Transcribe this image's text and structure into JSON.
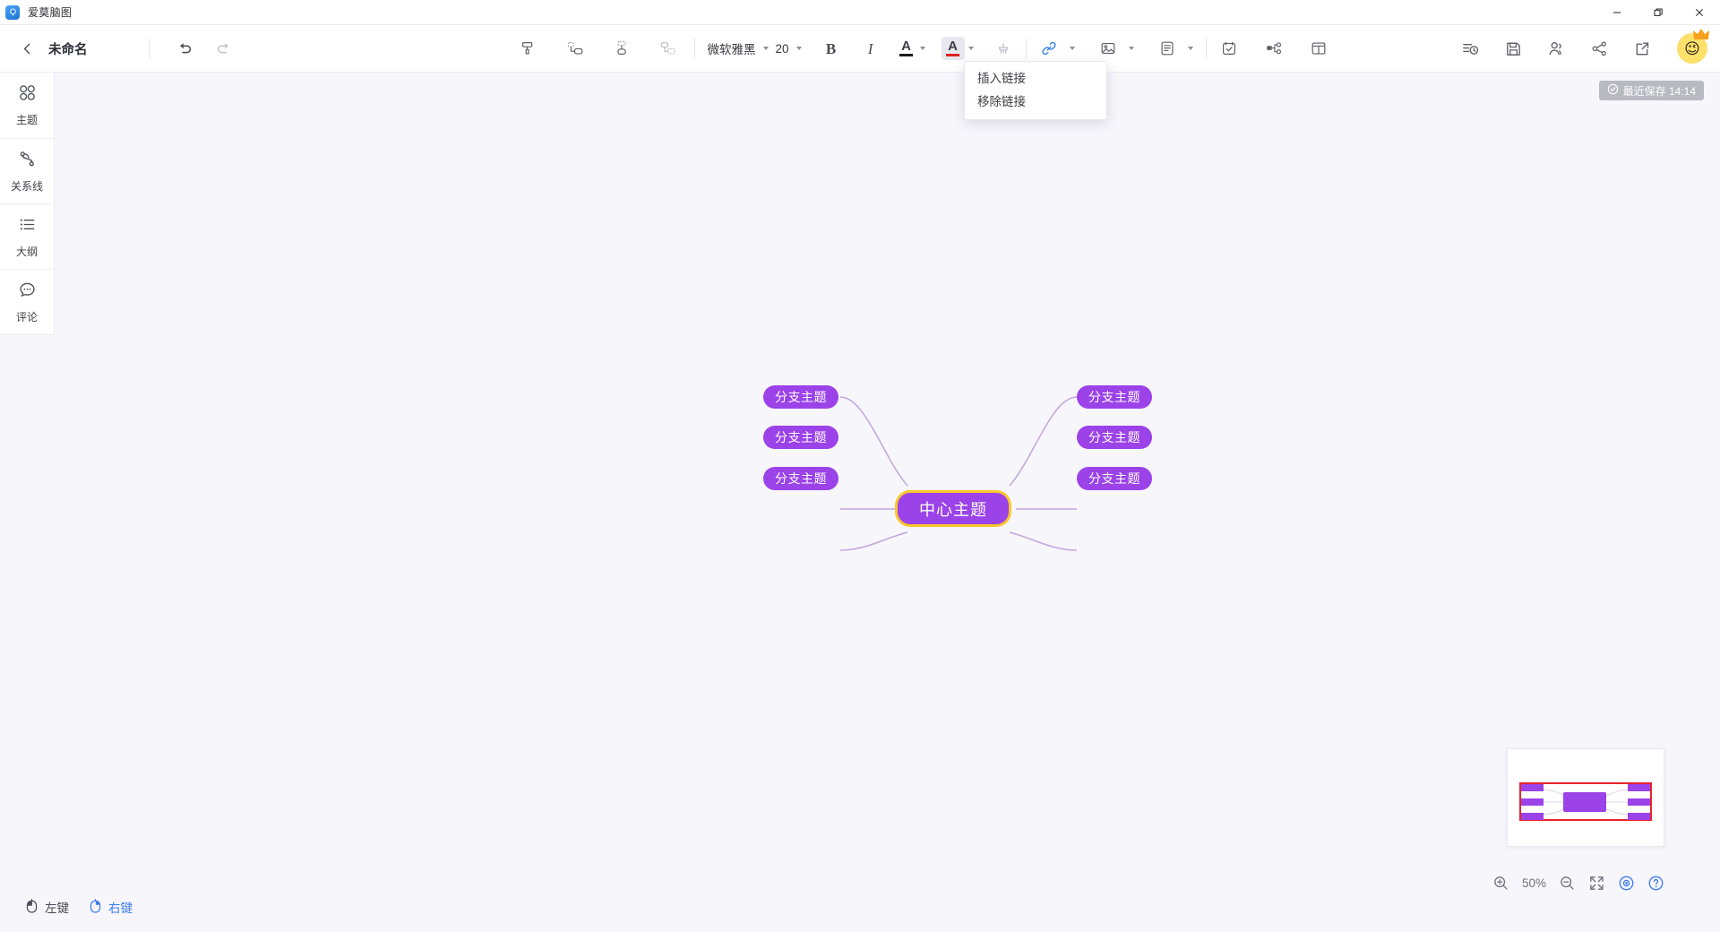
{
  "window": {
    "app_title": "爱莫脑图",
    "app_icon": "brain-map-app-icon",
    "minimize_label": "—",
    "maximize_label": "❐",
    "close_label": "✕"
  },
  "toolbar": {
    "back_icon": "chevron-left-icon",
    "doc_title": "未命名",
    "undo_icon": "undo-arrow-icon",
    "redo_icon": "redo-arrow-icon",
    "format_painter_icon": "format-painter-icon",
    "add_sibling_icon": "add-sibling-node-icon",
    "add_child_icon": "add-child-node-icon",
    "add_parent_icon": "add-parent-node-icon",
    "font_family": "微软雅黑",
    "font_size": "20",
    "bold_label": "B",
    "italic_label": "I",
    "text_color_label": "A",
    "text_color_hex": "#1b1b1b",
    "highlight_color_label": "A",
    "highlight_color_hex": "#e02121",
    "clear_format_icon": "clear-format-brush-icon",
    "link_icon": "link-icon",
    "link_icon_color": "#2f7fe8",
    "image_icon": "image-icon",
    "note_icon": "note-icon",
    "task_icon": "task-checkbox-icon",
    "relation_icon": "node-relation-icon",
    "layout_icon": "layout-template-icon",
    "history_icon": "history-icon",
    "save_icon": "save-floppy-icon",
    "members_icon": "members-icon",
    "share_icon": "share-icon",
    "export_icon": "export-external-link-icon",
    "avatar_icon": "winking-face-avatar",
    "avatar_crown_icon": "crown-icon",
    "avatar_face": "😉"
  },
  "link_menu": {
    "items": [
      {
        "label": "插入链接",
        "name": "insert-link"
      },
      {
        "label": "移除链接",
        "name": "remove-link"
      }
    ]
  },
  "sidebar": {
    "items": [
      {
        "label": "主题",
        "icon": "theme-four-petal-icon",
        "name": "theme"
      },
      {
        "label": "关系线",
        "icon": "relation-line-icon",
        "name": "relation-line"
      },
      {
        "label": "大纲",
        "icon": "outline-list-icon",
        "name": "outline"
      },
      {
        "label": "评论",
        "icon": "comment-bubble-icon",
        "name": "comment"
      }
    ]
  },
  "canvas": {
    "save_badge": {
      "icon": "check-circle-icon",
      "text": "最近保存 14:14"
    },
    "mindmap": {
      "center": {
        "label": "中心主题",
        "fill": "#9b42e8",
        "border": "#fbc62d"
      },
      "branches": [
        {
          "label": "分支主题",
          "side": "left",
          "row": 0
        },
        {
          "label": "分支主题",
          "side": "left",
          "row": 1
        },
        {
          "label": "分支主题",
          "side": "left",
          "row": 2
        },
        {
          "label": "分支主题",
          "side": "right",
          "row": 0
        },
        {
          "label": "分支主题",
          "side": "right",
          "row": 1
        },
        {
          "label": "分支主题",
          "side": "right",
          "row": 2
        }
      ],
      "branch_fill": "#9b42e8",
      "line_color": "#c0a6dd"
    }
  },
  "minimap": {
    "name": "minimap-panel",
    "viewport_border": "#e8232b",
    "node_fill": "#9b42e8"
  },
  "zoom_controls": {
    "zoom_in_icon": "zoom-in-icon",
    "zoom_level": "50%",
    "zoom_out_icon": "zoom-out-icon",
    "fit_screen_icon": "fit-screen-icon",
    "eye_icon": "eye-icon",
    "help_icon": "help-question-icon"
  },
  "mouse_mode": {
    "left": {
      "label": "左键",
      "icon": "mouse-left-button-icon",
      "active": false
    },
    "right": {
      "label": "右键",
      "icon": "mouse-right-button-icon",
      "active": true
    }
  }
}
